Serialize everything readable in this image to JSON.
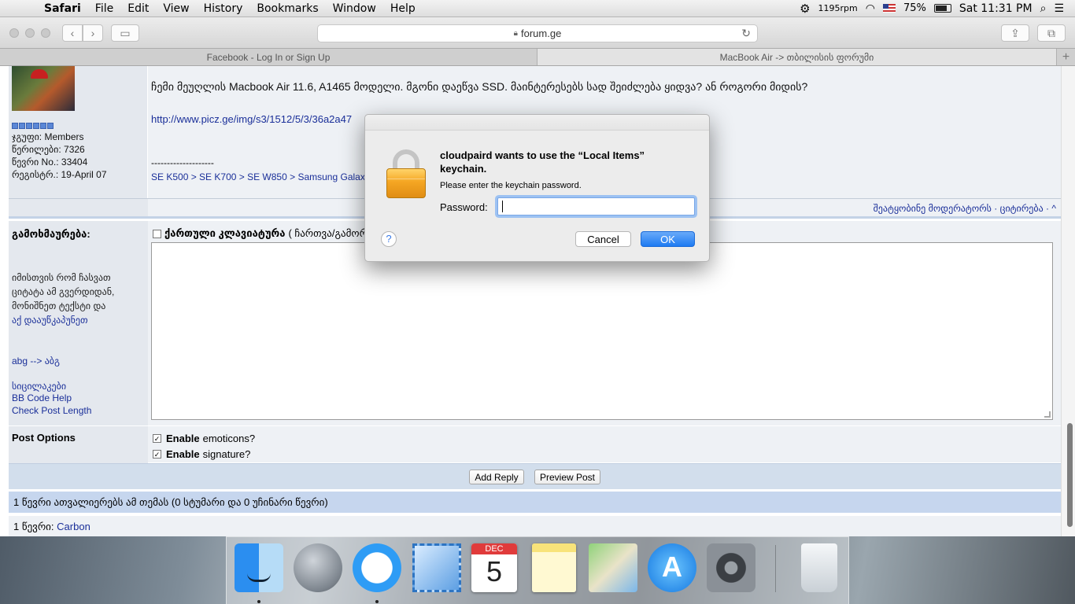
{
  "menubar": {
    "apple": "",
    "app": "Safari",
    "items": [
      "File",
      "Edit",
      "View",
      "History",
      "Bookmarks",
      "Window",
      "Help"
    ],
    "rpm": "1195rpm",
    "battery": "75%",
    "clock": "Sat 11:31 PM"
  },
  "toolbar": {
    "url": "forum.ge"
  },
  "tabs": [
    {
      "label": "Facebook - Log In or Sign Up"
    },
    {
      "label": "MacBook Air -> თბილისის ფორუმი"
    }
  ],
  "post": {
    "group_label": "ჯგუფი: Members",
    "posts_label": "წერილები: 7326",
    "member_no": "წევრი No.: 33404",
    "registered": "რეგისტრ.: 19-April 07",
    "body": "ჩემი მეუღლის Macbook Air 11.6, A1465 მოდელი. მგონი დაეწვა SSD. მაინტერესებს სად შეიძლება ყიდვა? ან როგორი მიდის?",
    "link": "http://www.picz.ge/img/s3/1512/5/3/36a2a47",
    "sig_sep": "--------------------",
    "signature": "SE K500 > SE K700 > SE W850 > Samsung Galax",
    "actions": "შეატყობინე მოდერატორს  · ციტირება · ^"
  },
  "reply": {
    "label": "გამოხმაურება:",
    "keyboard_toggle": "ქართული კლავიატურა",
    "keyboard_hint": "( ჩართვა/გამორ",
    "help_lines": [
      "იმისთვის რომ ჩასვათ",
      "ციტატა ამ გვერდიდან,",
      "მონიშნეთ ტექსტი და"
    ],
    "help_link": "აქ დააუწკაპუნეთ",
    "abg": "abg --> აბგ",
    "smilies": "სიცილაკები",
    "bbcode": "BB Code Help",
    "check_length": "Check Post Length"
  },
  "options": {
    "label": "Post Options",
    "emoticons_bold": "Enable",
    "emoticons_rest": "emoticons?",
    "signature_bold": "Enable",
    "signature_rest": "signature?",
    "check": "✓"
  },
  "buttons": {
    "add_reply": "Add Reply",
    "preview": "Preview Post"
  },
  "online": {
    "summary": "1 წევრი ათვალიერებს ამ თემას (0 სტუმარი და 0 უჩინარი წევრი)",
    "prefix": "1 წევრი:",
    "user": "Carbon"
  },
  "dialog": {
    "title": "cloudpaird wants to use the “Local Items” keychain.",
    "message": "Please enter the keychain password.",
    "password_label": "Password:",
    "cancel": "Cancel",
    "ok": "OK",
    "help": "?"
  },
  "dock": {
    "calendar_month": "DEC",
    "calendar_day": "5",
    "appstore_glyph": "A"
  }
}
